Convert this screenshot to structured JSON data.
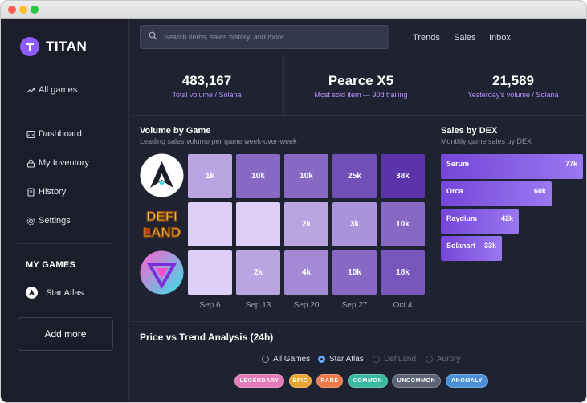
{
  "app": {
    "name": "TITAN"
  },
  "sidebar": {
    "items": [
      {
        "label": "All games",
        "icon": "trending-icon"
      },
      {
        "label": "Dashboard",
        "icon": "dashboard-icon"
      },
      {
        "label": "My Inventory",
        "icon": "lock-icon"
      },
      {
        "label": "History",
        "icon": "document-icon"
      },
      {
        "label": "Settings",
        "icon": "gear-icon"
      }
    ],
    "section_title": "MY GAMES",
    "games": [
      {
        "label": "Star Atlas",
        "icon": "star-atlas-icon"
      }
    ],
    "add_more": "Add more"
  },
  "header": {
    "search_placeholder": "Search items, sales history, and more...",
    "links": [
      "Trends",
      "Sales",
      "Inbox"
    ]
  },
  "stats": [
    {
      "value": "483,167",
      "label": "Total volume / Solana"
    },
    {
      "value": "Pearce X5",
      "label": "Most sold item — 90d trailing"
    },
    {
      "value": "21,589",
      "label": "Yesterday's volume / Solana"
    }
  ],
  "volume_by_game": {
    "title": "Volume by Game",
    "subtitle": "Leading sales volume per game week-over-week",
    "games": [
      "Star Atlas",
      "DefiLand",
      "Aurory"
    ],
    "logo_texts": {
      "defiland_top": "DEFI",
      "defiland_bottom": "LAND"
    },
    "weeks": [
      "Sep 6",
      "Sep 13",
      "Sep 20",
      "Sep 27",
      "Oct 4"
    ],
    "rows": [
      [
        "1k",
        "10k",
        "10k",
        "25k",
        "38k"
      ],
      [
        "",
        "",
        "2k",
        "3k",
        "10k"
      ],
      [
        "",
        "2k",
        "4k",
        "10k",
        "18k"
      ]
    ],
    "levels": [
      [
        0.35,
        0.7,
        0.7,
        0.85,
        1.0
      ],
      [
        0.1,
        0.1,
        0.35,
        0.45,
        0.7
      ],
      [
        0.1,
        0.35,
        0.5,
        0.7,
        0.8
      ]
    ]
  },
  "sales_by_dex": {
    "title": "Sales by DEX",
    "subtitle": "Monthly game sales by DEX",
    "chart_data": {
      "type": "bar",
      "categories": [
        "Serum",
        "Orca",
        "Raydium",
        "Solanart"
      ],
      "values": [
        77,
        60,
        42,
        33
      ],
      "value_labels": [
        "77k",
        "60k",
        "42k",
        "33k"
      ],
      "xlim": [
        0,
        77
      ]
    }
  },
  "price_trend": {
    "title": "Price vs Trend Analysis (24h)",
    "filters": [
      {
        "label": "All Games",
        "selected": false,
        "enabled": true
      },
      {
        "label": "Star Atlas",
        "selected": true,
        "enabled": true
      },
      {
        "label": "DefiLand",
        "selected": false,
        "enabled": false
      },
      {
        "label": "Aurory",
        "selected": false,
        "enabled": false
      }
    ],
    "rarities": [
      {
        "label": "LEGENDARY",
        "color": "#e57ab8"
      },
      {
        "label": "EPIC",
        "color": "#e8a531"
      },
      {
        "label": "RARE",
        "color": "#ec7a4b"
      },
      {
        "label": "COMMON",
        "color": "#39b9a0"
      },
      {
        "label": "UNCOMMON",
        "color": "#5e6478"
      },
      {
        "label": "ANOMALY",
        "color": "#4a8fd8"
      }
    ]
  },
  "colors": {
    "accent": "#8e5bff",
    "background": "#1f2230",
    "sidebar": "#1b1e2a"
  }
}
